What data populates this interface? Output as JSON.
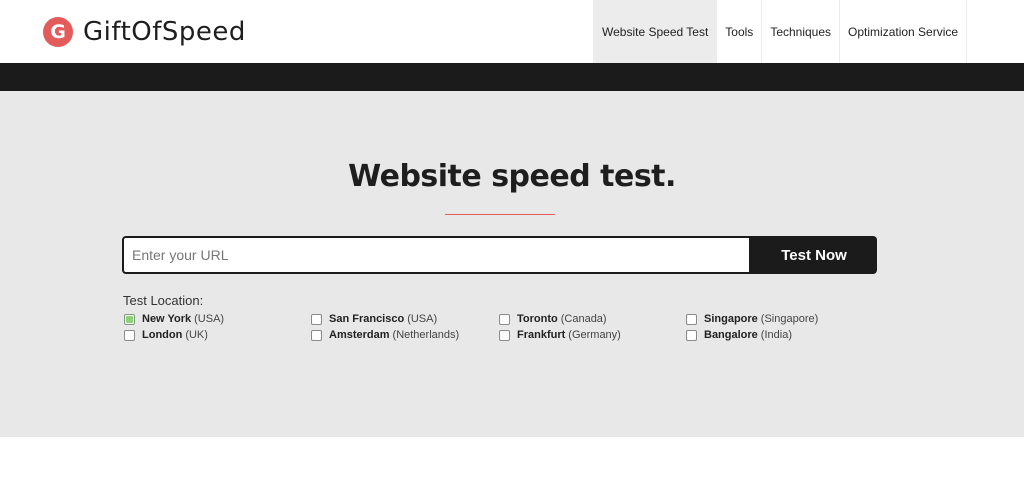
{
  "header": {
    "logo_letter": "G",
    "logo_text": "GiftOfSpeed",
    "nav": [
      {
        "label": "Website Speed Test",
        "active": true
      },
      {
        "label": "Tools",
        "active": false
      },
      {
        "label": "Techniques",
        "active": false
      },
      {
        "label": "Optimization Service",
        "active": false
      }
    ]
  },
  "hero": {
    "title": "Website speed test.",
    "url_placeholder": "Enter your URL",
    "url_value": "",
    "button_label": "Test Now",
    "location_label": "Test Location:",
    "locations": [
      {
        "city": "New York",
        "country": "(USA)",
        "checked": true
      },
      {
        "city": "London",
        "country": "(UK)",
        "checked": false
      },
      {
        "city": "San Francisco",
        "country": "(USA)",
        "checked": false
      },
      {
        "city": "Amsterdam",
        "country": "(Netherlands)",
        "checked": false
      },
      {
        "city": "Toronto",
        "country": "(Canada)",
        "checked": false
      },
      {
        "city": "Frankfurt",
        "country": "(Germany)",
        "checked": false
      },
      {
        "city": "Singapore",
        "country": "(Singapore)",
        "checked": false
      },
      {
        "city": "Bangalore",
        "country": "(India)",
        "checked": false
      }
    ]
  },
  "colors": {
    "accent": "#e35b5b",
    "dark": "#1b1b1b",
    "hero_bg": "#e8e8e8",
    "checked": "#8ed17a"
  }
}
